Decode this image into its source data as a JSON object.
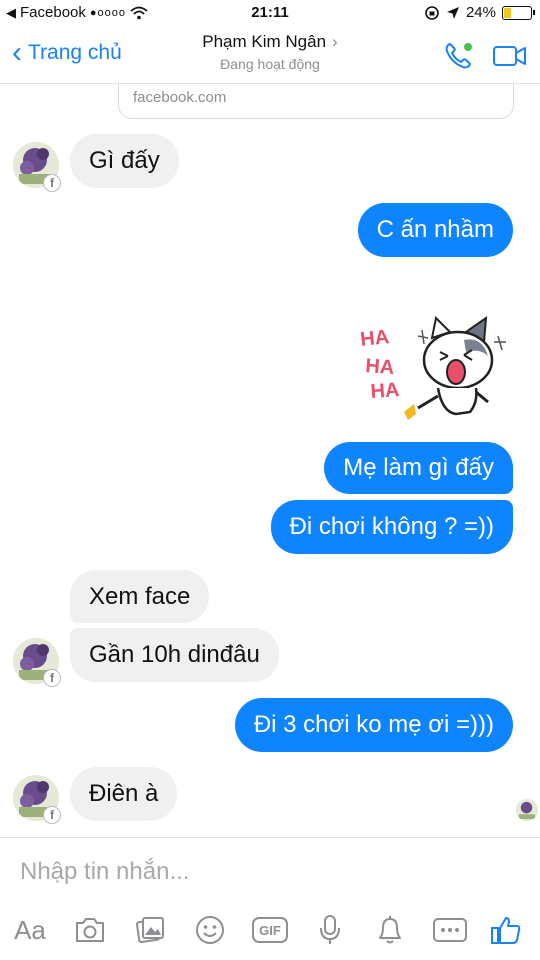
{
  "status_bar": {
    "back_app": "Facebook",
    "signal": "●oooo",
    "time": "21:11",
    "battery": "24%",
    "battery_level": 0.24,
    "battery_color": "#f5c518"
  },
  "nav": {
    "back_label": "Trang chủ",
    "contact_name": "Phạm Kim Ngân",
    "contact_status": "Đang hoạt động",
    "accent": "#1a82f7",
    "active_dot_color": "#44c04a"
  },
  "link_preview": {
    "domain": "facebook.com"
  },
  "messages": [
    {
      "direction": "in",
      "text": "Gì đấy"
    },
    {
      "direction": "out",
      "text": "C ấn nhầm"
    },
    {
      "direction": "out",
      "type": "sticker",
      "sticker_text": [
        "HA",
        "HA",
        "HA"
      ]
    },
    {
      "direction": "out",
      "text": "Mẹ làm gì đấy"
    },
    {
      "direction": "out",
      "text": "Đi chơi không ? =))"
    },
    {
      "direction": "in",
      "text": "Xem face"
    },
    {
      "direction": "in",
      "text": "Gần 10h dinđâu"
    },
    {
      "direction": "out",
      "text": "Đi 3 chơi ko mẹ ơi =)))"
    },
    {
      "direction": "in",
      "text": "Điên à"
    }
  ],
  "bubble_colors": {
    "incoming": "#f1f0f0",
    "outgoing": "#0e84ff"
  },
  "avatar_badge": "f",
  "composer": {
    "placeholder": "Nhập tin nhắn...",
    "value": "",
    "toolbar": {
      "text_format_label": "Aa",
      "gif_label": "GIF",
      "icons": [
        "camera-icon",
        "gallery-icon",
        "emoji-icon",
        "gif-icon",
        "microphone-icon",
        "bell-icon",
        "more-icon",
        "thumbs-up-icon"
      ]
    }
  }
}
